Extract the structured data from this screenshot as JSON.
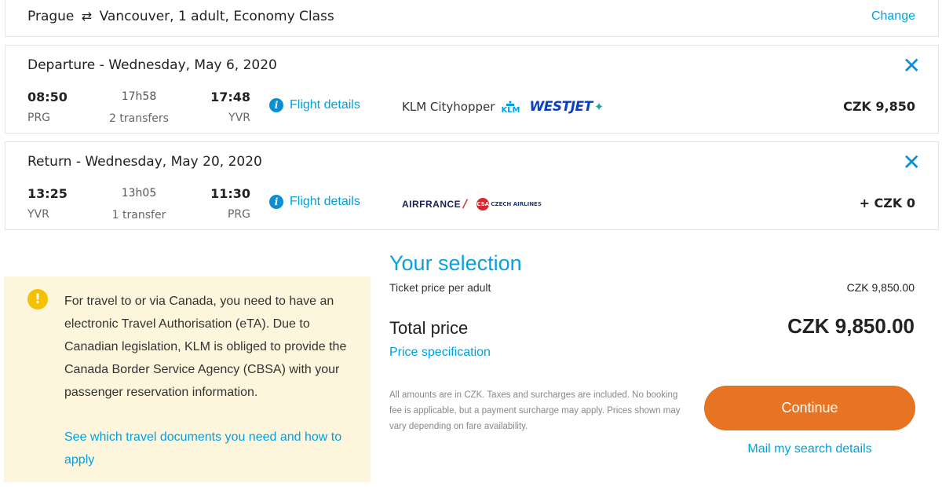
{
  "search_summary": {
    "origin": "Prague",
    "swap_icon": "⇄",
    "rest": "Vancouver, 1 adult, Economy Class",
    "change_label": "Change"
  },
  "departure": {
    "title": "Departure - Wednesday, May 6, 2020",
    "dep_time": "08:50",
    "dep_airport": "PRG",
    "duration": "17h58",
    "transfers": "2 transfers",
    "arr_time": "17:48",
    "arr_airport": "YVR",
    "details_label": "Flight details",
    "airline": "KLM Cityhopper",
    "logo_klm": "KLM",
    "logo_westjet": "WESTJET",
    "price": "CZK 9,850"
  },
  "return": {
    "title": "Return - Wednesday, May 20, 2020",
    "dep_time": "13:25",
    "dep_airport": "YVR",
    "duration": "13h05",
    "transfers": "1 transfer",
    "arr_time": "11:30",
    "arr_airport": "PRG",
    "details_label": "Flight details",
    "logo_airfrance": "AIRFRANCE",
    "logo_czech": "CZECH AIRLINES",
    "price": "+ CZK 0"
  },
  "notice": {
    "text": "For travel to or via Canada, you need to have an electronic Travel Authorisation (eTA). Due to Canadian legislation, KLM is obliged to provide the Canada Border Service Agency (CBSA) with your passenger reservation information.",
    "link": "See which travel documents you need and how to apply"
  },
  "selection": {
    "title": "Your selection",
    "ticket_label": "Ticket price per adult",
    "ticket_value": "CZK 9,850.00",
    "total_label": "Total price",
    "total_value": "CZK 9,850.00",
    "price_spec": "Price specification",
    "disclaimer": "All amounts are in CZK. Taxes and surcharges are included. No booking fee is applicable, but a payment surcharge may apply. Prices shown may vary depending on fare availability.",
    "continue_label": "Continue",
    "mail_label": "Mail my search details"
  },
  "colors": {
    "link": "#00a1de",
    "continue": "#e67423",
    "notice_bg": "#fdf6dc",
    "warning": "#f3c100"
  }
}
